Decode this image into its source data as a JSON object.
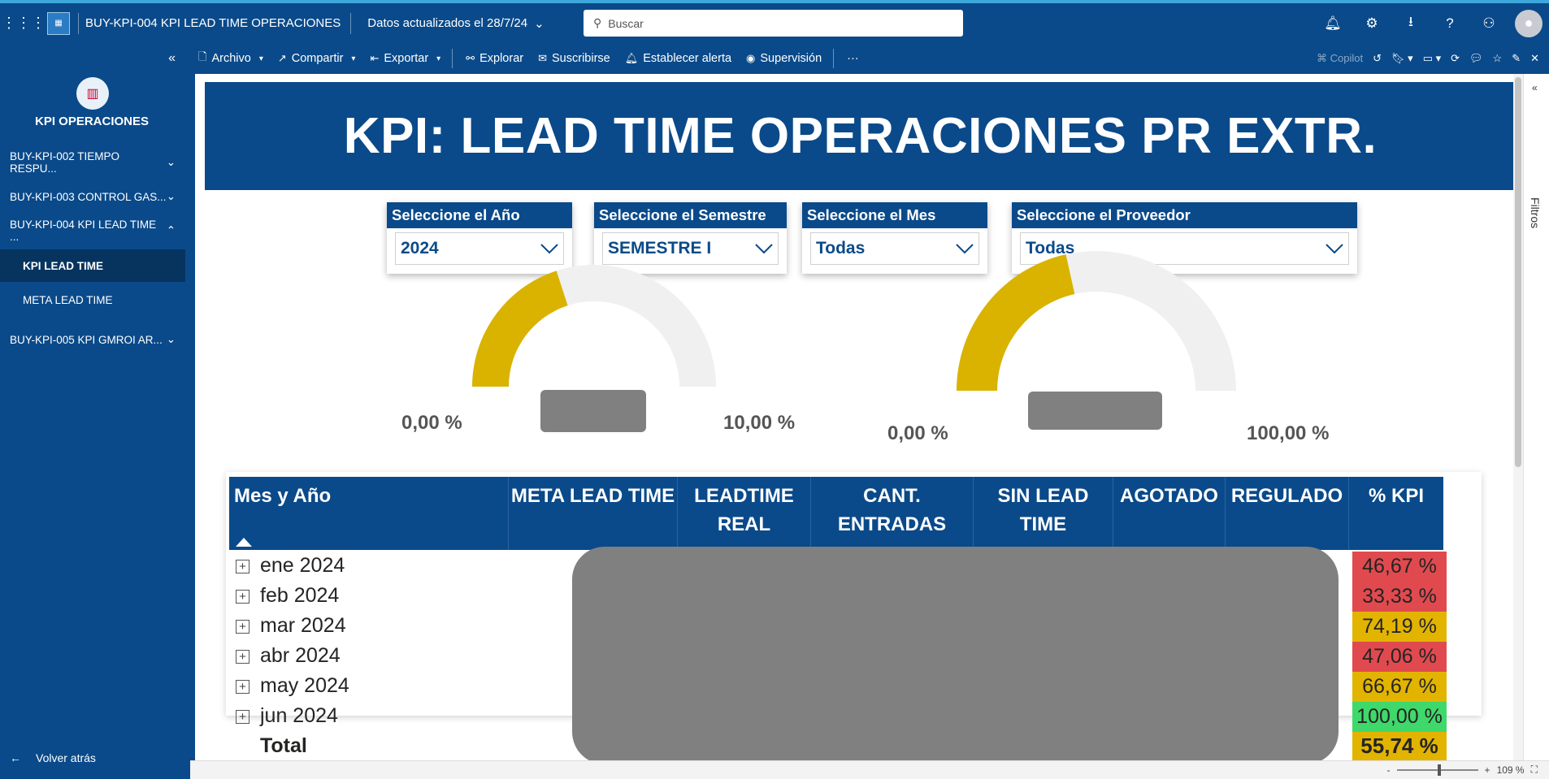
{
  "topbar": {
    "report_title": "BUY-KPI-004 KPI LEAD TIME OPERACIONES",
    "updated": "Datos actualizados el 28/7/24",
    "search_placeholder": "Buscar"
  },
  "sidebar": {
    "app_title": "KPI OPERACIONES",
    "items": [
      {
        "label": "BUY-KPI-002 TIEMPO RESPU..."
      },
      {
        "label": "BUY-KPI-003 CONTROL GAS..."
      },
      {
        "label": "BUY-KPI-004 KPI LEAD TIME ..."
      },
      {
        "label": "KPI LEAD TIME"
      },
      {
        "label": "META LEAD TIME"
      },
      {
        "label": "BUY-KPI-005 KPI GMROI AR..."
      }
    ],
    "back_label": "Volver atrás"
  },
  "toolbar": {
    "archivo": "Archivo",
    "compartir": "Compartir",
    "exportar": "Exportar",
    "explorar": "Explorar",
    "suscribirse": "Suscribirse",
    "alerta": "Establecer alerta",
    "supervision": "Supervisión",
    "more": "···",
    "copilot": "Copilot"
  },
  "report": {
    "banner_title": "KPI: LEAD TIME OPERACIONES PR EXTR.",
    "slicers": [
      {
        "header": "Seleccione el Año",
        "value": "2024"
      },
      {
        "header": "Seleccione el Semestre",
        "value": "SEMESTRE I"
      },
      {
        "header": "Seleccione el Mes",
        "value": "Todas"
      },
      {
        "header": "Seleccione el Proveedor",
        "value": "Todas"
      }
    ],
    "gauges": [
      {
        "min_label": "0,00 %",
        "max_label": "10,00 %",
        "fill_fraction": 0.4
      },
      {
        "min_label": "0,00 %",
        "max_label": "100,00 %",
        "fill_fraction": 0.43
      }
    ],
    "table": {
      "headers": [
        "Mes y Año",
        "META LEAD TIME",
        "LEADTIME REAL",
        "CANT. ENTRADAS",
        "SIN LEAD TIME",
        "AGOTADO",
        "REGULADO",
        "% KPI"
      ],
      "rows": [
        {
          "label": "ene 2024",
          "kpi": "46,67 %",
          "color": "#e04a4f"
        },
        {
          "label": "feb 2024",
          "kpi": "33,33 %",
          "color": "#e04a4f"
        },
        {
          "label": "mar 2024",
          "kpi": "74,19 %",
          "color": "#e2b400"
        },
        {
          "label": "abr 2024",
          "kpi": "47,06 %",
          "color": "#e04a4f"
        },
        {
          "label": "may 2024",
          "kpi": "66,67 %",
          "color": "#e2b400"
        },
        {
          "label": "jun 2024",
          "kpi": "100,00 %",
          "color": "#3fd86a"
        }
      ],
      "total": {
        "label": "Total",
        "kpi": "55,74 %",
        "color": "#e2b400"
      }
    }
  },
  "filters_pane": {
    "label": "Filtros"
  },
  "statusbar": {
    "zoom": "109 %"
  },
  "colors": {
    "brand": "#0a4a8a",
    "gauge_fill": "#d9b300",
    "gauge_track": "#f0f0f0"
  }
}
